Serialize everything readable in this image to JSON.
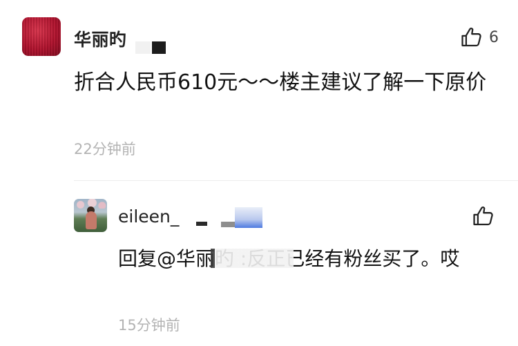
{
  "comment": {
    "username": "华丽旳",
    "text": "折合人民币610元～～楼主建议了解一下原价",
    "time": "22分钟前",
    "like_count": "6",
    "like_icon": "thumbs-up-icon",
    "avatar_color": "#b0122d"
  },
  "reply": {
    "username": "eileen_",
    "text": "回复@华丽旳 :反正已经有粉丝买了。哎",
    "time": "15分钟前",
    "like_icon": "thumbs-up-icon"
  }
}
